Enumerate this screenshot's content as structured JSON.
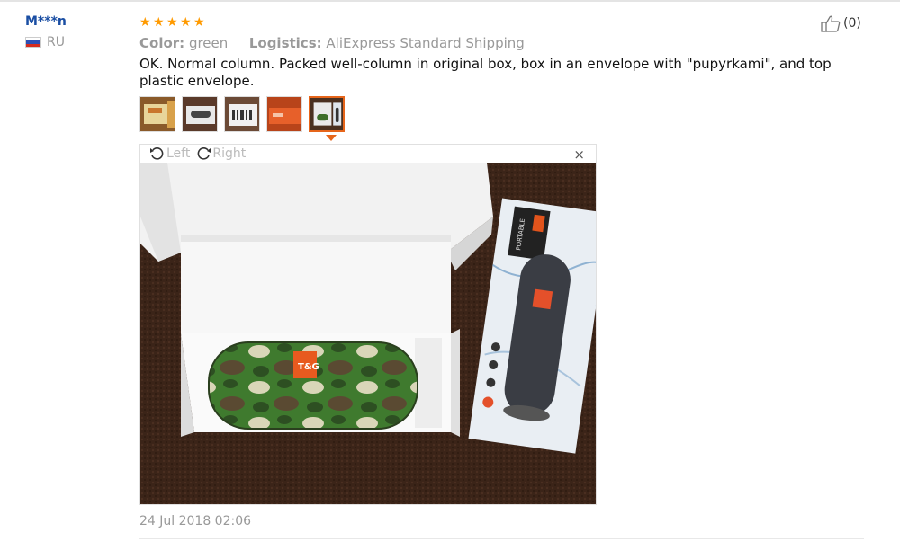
{
  "buyer": {
    "name": "M***n",
    "country": "RU"
  },
  "review": {
    "stars": 5,
    "color_label": "Color:",
    "color_value": "green",
    "logistics_label": "Logistics:",
    "logistics_value": "AliExpress Standard Shipping",
    "text": "OK. Normal column. Packed well-column in original box, box in an envelope with \"pupyrkami\", and top plastic envelope.",
    "date": "24 Jul 2018 02:06",
    "helpful_count": "(0)"
  },
  "viewer": {
    "rotate_left": "Left",
    "rotate_right": "Right",
    "close": "×"
  },
  "image_text": {
    "box_badge": "T&G",
    "box_side": "PORTABLE"
  },
  "colors": {
    "star": "#ff9a00",
    "buyer_name": "#1a4ea3",
    "active_thumb": "#e6651a"
  }
}
